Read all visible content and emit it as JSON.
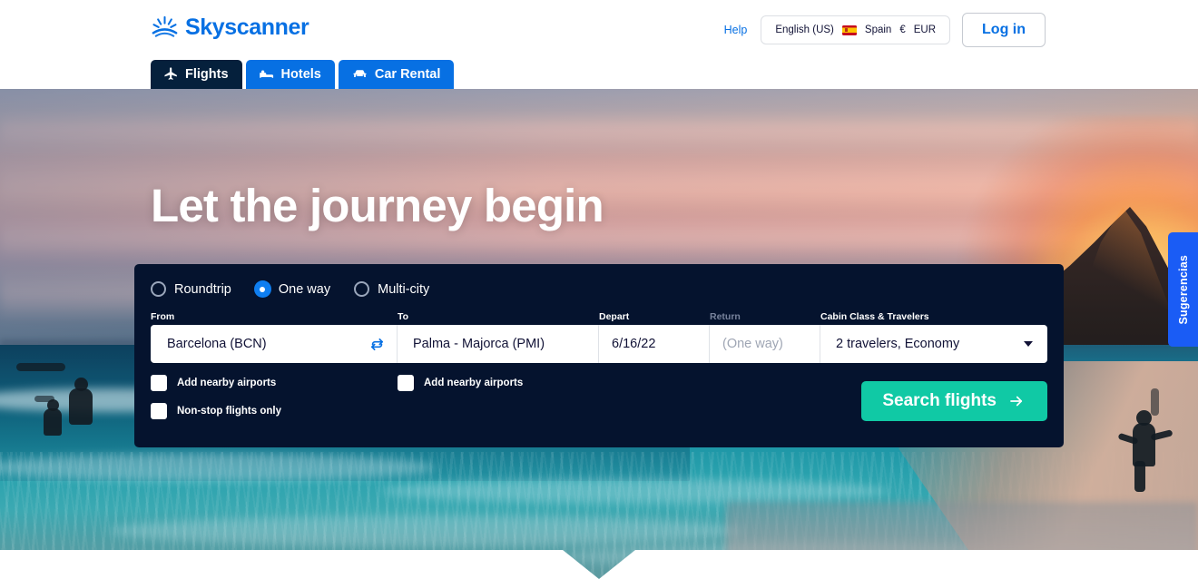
{
  "header": {
    "logo_text": "Skyscanner",
    "logo_icon": "sunburst-icon",
    "help_label": "Help",
    "locale": {
      "language": "English (US)",
      "flag_icon": "spain-flag-icon",
      "country": "Spain",
      "currency_symbol": "€",
      "currency_code": "EUR"
    },
    "login_label": "Log in",
    "tabs": [
      {
        "label": "Flights",
        "icon": "plane-icon",
        "active": true
      },
      {
        "label": "Hotels",
        "icon": "bed-icon",
        "active": false
      },
      {
        "label": "Car Rental",
        "icon": "car-icon",
        "active": false
      }
    ]
  },
  "hero": {
    "headline": "Let the journey begin"
  },
  "search": {
    "trip_types": [
      {
        "label": "Roundtrip",
        "selected": false
      },
      {
        "label": "One way",
        "selected": true
      },
      {
        "label": "Multi-city",
        "selected": false
      }
    ],
    "labels": {
      "from": "From",
      "to": "To",
      "depart": "Depart",
      "return": "Return",
      "cabin": "Cabin Class & Travelers"
    },
    "values": {
      "from": "Barcelona (BCN)",
      "to": "Palma - Majorca (PMI)",
      "depart": "6/16/22",
      "return_placeholder": "(One way)",
      "cabin": "2 travelers, Economy"
    },
    "swap_icon": "swap-arrows-icon",
    "caret_icon": "chevron-down-icon",
    "options": {
      "nearby_from": "Add nearby airports",
      "nearby_to": "Add nearby airports",
      "nonstop": "Non-stop flights only"
    },
    "submit_label": "Search flights",
    "submit_icon": "arrow-right-icon"
  },
  "suggestions_tab": {
    "label": "Sugerencias"
  },
  "colors": {
    "brand_blue": "#0770e3",
    "tab_active": "#05203c",
    "panel_navy": "#05132e",
    "cta_teal": "#10c9a5",
    "suggestions_blue": "#1a5cf5"
  }
}
